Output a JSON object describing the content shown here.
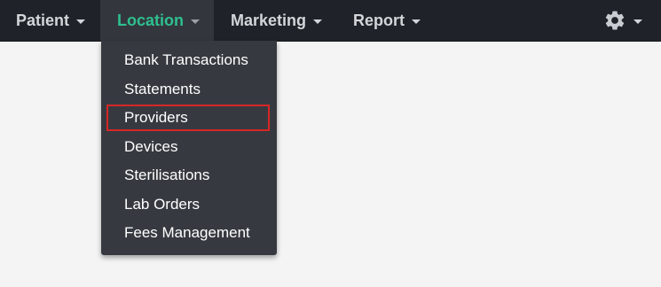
{
  "navbar": {
    "items": [
      {
        "label": "Patient"
      },
      {
        "label": "Location"
      },
      {
        "label": "Marketing"
      },
      {
        "label": "Report"
      }
    ],
    "active_index": 1,
    "settings_icon": "gear-icon"
  },
  "dropdown": {
    "items": [
      {
        "label": "Bank Transactions"
      },
      {
        "label": "Statements"
      },
      {
        "label": "Providers"
      },
      {
        "label": "Devices"
      },
      {
        "label": "Sterilisations"
      },
      {
        "label": "Lab Orders"
      },
      {
        "label": "Fees Management"
      }
    ],
    "highlighted_index": 2
  },
  "colors": {
    "navbar_bg": "#1f2329",
    "active_bg": "#33373d",
    "active_text": "#2ec08f",
    "dropdown_bg": "#363a40",
    "highlight_border": "#d62626"
  }
}
